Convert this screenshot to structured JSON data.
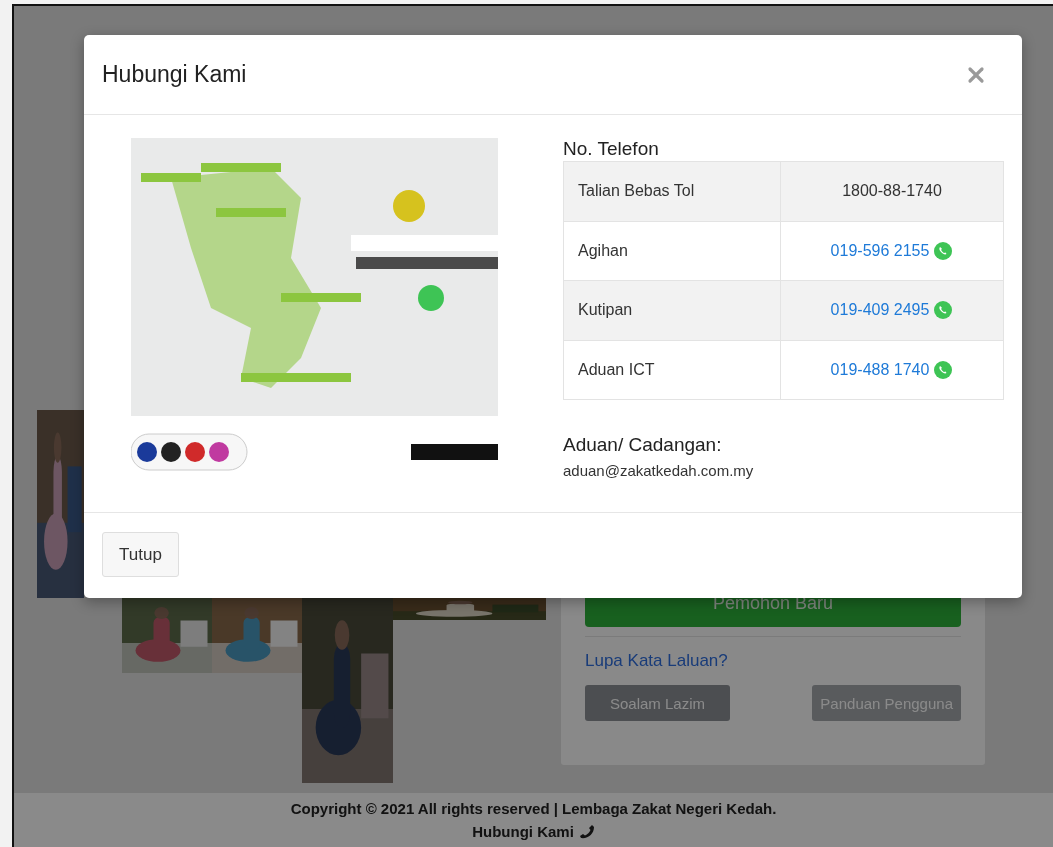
{
  "page": {
    "new_applicant_button": "Pemohon Baru",
    "forgot_link": "Lupa Kata Laluan?",
    "faq_button": "Soalam Lazim",
    "guide_button": "Panduan Pengguna"
  },
  "footer": {
    "copyright": "Copyright © 2021 All rights reserved | Lembaga Zakat Negeri Kedah.",
    "contact": "Hubungi Kami"
  },
  "modal": {
    "title": "Hubungi Kami",
    "phone_heading": "No. Telefon",
    "phones": [
      {
        "label": "Talian Bebas Tol",
        "number": "1800-88-1740",
        "kind": "plain"
      },
      {
        "label": "Agihan",
        "number": "019-596 2155",
        "kind": "whatsapp"
      },
      {
        "label": "Kutipan",
        "number": "019-409 2495",
        "kind": "whatsapp"
      },
      {
        "label": "Aduan ICT",
        "number": "019-488 1740",
        "kind": "whatsapp"
      }
    ],
    "complaint_heading": "Aduan/ Cadangan:",
    "email": "aduan@zakatkedah.com.my",
    "close_button": "Tutup"
  }
}
